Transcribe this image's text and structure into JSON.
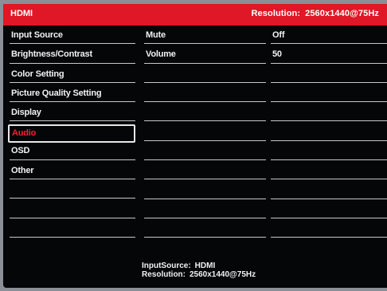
{
  "header": {
    "title": "HDMI",
    "resolution_label": "Resolution:",
    "resolution_value": "2560x1440@75Hz"
  },
  "menu": {
    "items": [
      {
        "label": "Input Source"
      },
      {
        "label": "Brightness/Contrast"
      },
      {
        "label": "Color Setting"
      },
      {
        "label": "Picture Quality Setting"
      },
      {
        "label": "Display"
      },
      {
        "label": "Audio",
        "selected": true
      },
      {
        "label": "OSD"
      },
      {
        "label": "Other"
      },
      {
        "label": ""
      },
      {
        "label": ""
      },
      {
        "label": ""
      }
    ]
  },
  "submenu": {
    "items": [
      {
        "label": "Mute"
      },
      {
        "label": "Volume"
      },
      {
        "label": ""
      },
      {
        "label": ""
      },
      {
        "label": ""
      },
      {
        "label": ""
      },
      {
        "label": ""
      },
      {
        "label": ""
      },
      {
        "label": ""
      },
      {
        "label": ""
      },
      {
        "label": ""
      }
    ]
  },
  "values": {
    "items": [
      {
        "label": "Off"
      },
      {
        "label": "50"
      },
      {
        "label": ""
      },
      {
        "label": ""
      },
      {
        "label": ""
      },
      {
        "label": ""
      },
      {
        "label": ""
      },
      {
        "label": ""
      },
      {
        "label": ""
      },
      {
        "label": ""
      },
      {
        "label": ""
      }
    ]
  },
  "footer": {
    "input_label": "InputSource:",
    "input_value": "HDMI",
    "resolution_label": "Resolution:",
    "resolution_value": "2560x1440@75Hz"
  },
  "colors": {
    "accent": "#e01726",
    "selected_text": "#f02230",
    "background": "#050608"
  }
}
